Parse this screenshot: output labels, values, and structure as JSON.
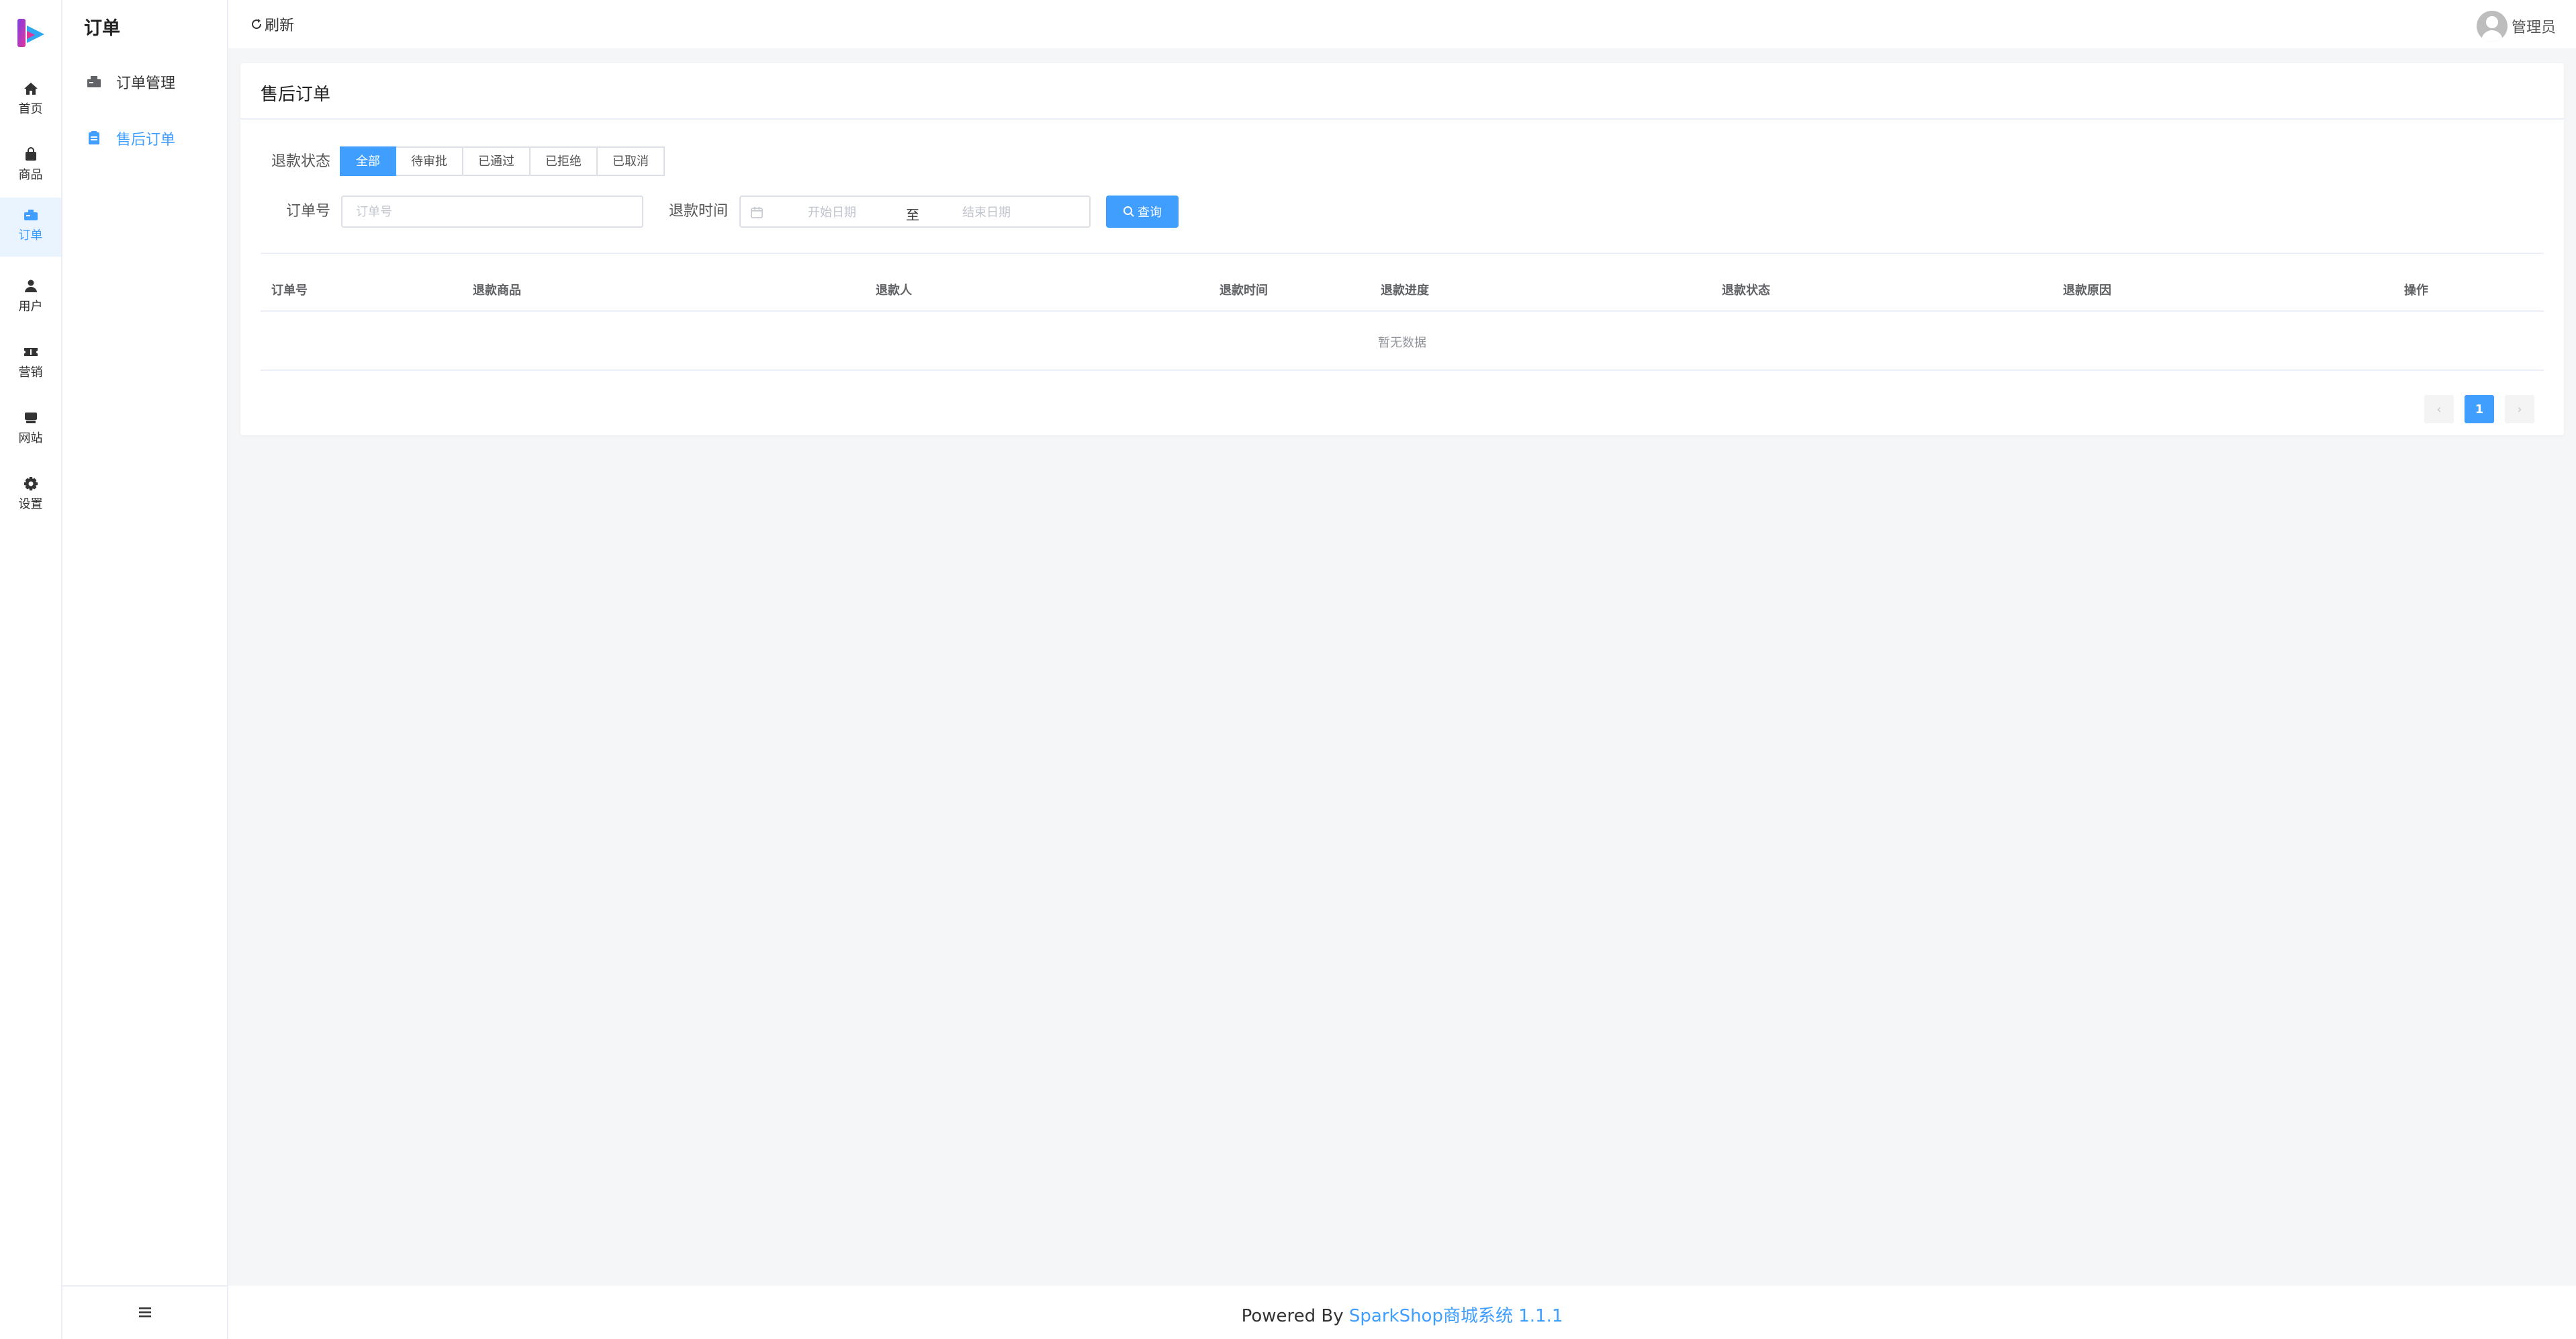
{
  "rail": {
    "items": [
      {
        "label": "首页",
        "icon": "home-icon"
      },
      {
        "label": "商品",
        "icon": "bag-icon"
      },
      {
        "label": "订单",
        "icon": "order-icon"
      },
      {
        "label": "用户",
        "icon": "user-icon"
      },
      {
        "label": "营销",
        "icon": "ticket-icon"
      },
      {
        "label": "网站",
        "icon": "store-icon"
      },
      {
        "label": "设置",
        "icon": "gear-icon"
      }
    ],
    "active_index": 2
  },
  "subnav": {
    "title": "订单",
    "items": [
      {
        "label": "订单管理",
        "icon": "list-icon"
      },
      {
        "label": "售后订单",
        "icon": "clipboard-icon"
      }
    ],
    "active_index": 1
  },
  "topbar": {
    "refresh_label": "刷新",
    "user_name": "管理员"
  },
  "card": {
    "title": "售后订单",
    "status_label": "退款状态",
    "status_options": [
      "全部",
      "待审批",
      "已通过",
      "已拒绝",
      "已取消"
    ],
    "status_selected": "全部",
    "order_no_label": "订单号",
    "order_no_placeholder": "订单号",
    "order_no_value": "",
    "refund_time_label": "退款时间",
    "start_date_placeholder": "开始日期",
    "end_date_placeholder": "结束日期",
    "range_separator": "至",
    "search_label": "查询"
  },
  "table": {
    "columns": [
      "订单号",
      "退款商品",
      "退款人",
      "退款时间",
      "退款进度",
      "退款状态",
      "退款原因",
      "操作"
    ],
    "rows": [],
    "empty_text": "暂无数据"
  },
  "pagination": {
    "current_page": "1",
    "prev_symbol": "‹",
    "next_symbol": "›"
  },
  "footer": {
    "prefix": "Powered By ",
    "link_text": "SparkShop商城系统 1.1.1"
  },
  "colors": {
    "accent": "#409eff",
    "logo_pink": "#e0369a",
    "logo_blue": "#2fa8f3"
  }
}
